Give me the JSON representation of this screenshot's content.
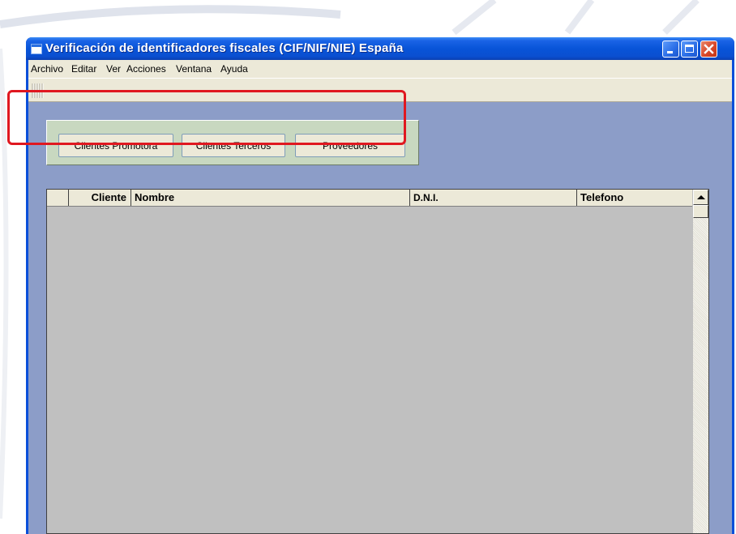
{
  "window": {
    "title": "Verificación de identificadores fiscales (CIF/NIF/NIE) España"
  },
  "menu": [
    "Archivo",
    "Editar",
    "Ver",
    "Acciones",
    "Ventana",
    "Ayuda"
  ],
  "buttons": {
    "clientes_promotora": "Clientes Promotora",
    "clientes_terceros": "Clientes Terceros",
    "proveedores": "Proveedores"
  },
  "grid": {
    "columns": [
      "Cliente",
      "Nombre",
      "D.N.I.",
      "Telefono"
    ],
    "rows": []
  },
  "colors": {
    "titlebar": "#0a4fd9",
    "mdi_background": "#8c9dc8",
    "button_panel": "#c8d8c0",
    "highlight": "#e01820",
    "grid_background": "#c0c0c0"
  }
}
